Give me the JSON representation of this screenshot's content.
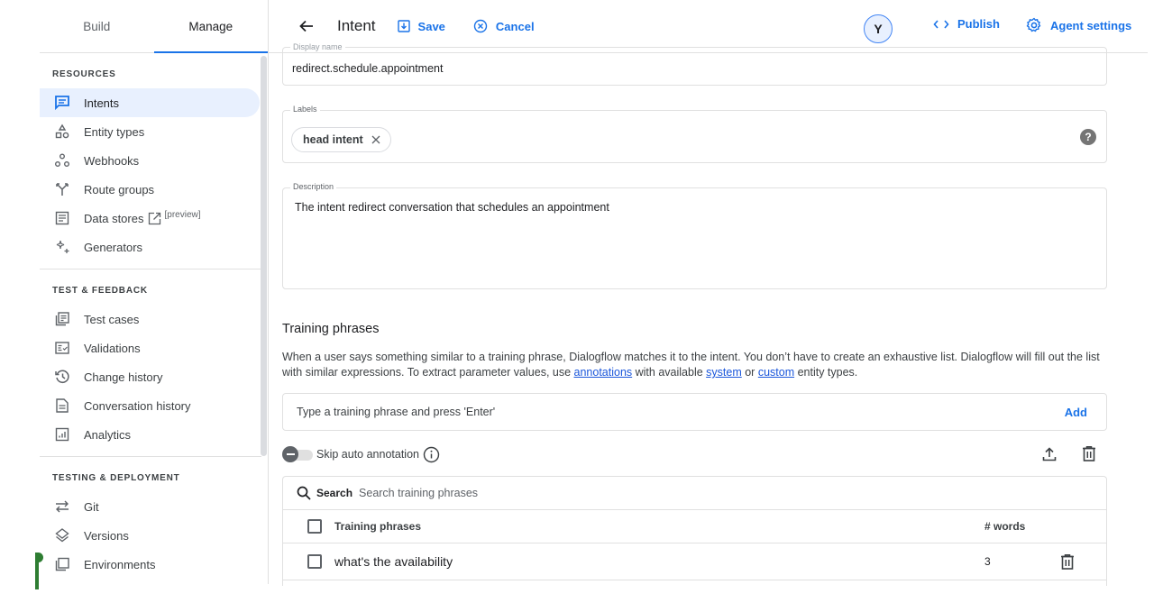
{
  "sidebar": {
    "tabs": [
      {
        "label": "Build",
        "active": false
      },
      {
        "label": "Manage",
        "active": true
      }
    ],
    "sections": {
      "resources": {
        "title": "RESOURCES",
        "items": [
          {
            "label": "Intents",
            "icon": "intents-icon",
            "active": true
          },
          {
            "label": "Entity types",
            "icon": "entity-types-icon"
          },
          {
            "label": "Webhooks",
            "icon": "webhooks-icon"
          },
          {
            "label": "Route groups",
            "icon": "route-groups-icon"
          },
          {
            "label": "Data stores",
            "icon": "data-stores-icon",
            "tag": "[preview]"
          },
          {
            "label": "Generators",
            "icon": "generators-icon"
          }
        ]
      },
      "test_feedback": {
        "title": "TEST & FEEDBACK",
        "items": [
          {
            "label": "Test cases",
            "icon": "test-cases-icon"
          },
          {
            "label": "Validations",
            "icon": "validations-icon"
          },
          {
            "label": "Change history",
            "icon": "change-history-icon"
          },
          {
            "label": "Conversation history",
            "icon": "conversation-history-icon"
          },
          {
            "label": "Analytics",
            "icon": "analytics-icon"
          }
        ]
      },
      "testing_deployment": {
        "title": "TESTING & DEPLOYMENT",
        "items": [
          {
            "label": "Git",
            "icon": "git-icon"
          },
          {
            "label": "Versions",
            "icon": "versions-icon"
          },
          {
            "label": "Environments",
            "icon": "environments-icon"
          }
        ]
      }
    }
  },
  "header": {
    "title": "Intent",
    "save_label": "Save",
    "cancel_label": "Cancel",
    "avatar_initial": "Y",
    "publish_label": "Publish",
    "agent_settings_label": "Agent settings"
  },
  "form": {
    "display_name": {
      "label": "Display name",
      "value": "redirect.schedule.appointment"
    },
    "labels": {
      "label": "Labels",
      "chips": [
        "head intent"
      ]
    },
    "description": {
      "label": "Description",
      "value": "The intent redirect conversation that schedules an appointment"
    }
  },
  "training": {
    "title": "Training phrases",
    "desc_part1": "When a user says something similar to a training phrase, Dialogflow matches it to the intent. You don’t have to create an exhaustive list. Dialogflow will fill out the list with similar expressions. To extract parameter values, use ",
    "link_annotations": "annotations",
    "desc_part2": " with available ",
    "link_system": "system",
    "desc_part3": " or ",
    "link_custom": "custom",
    "desc_part4": " entity types.",
    "input_placeholder": "Type a training phrase and press 'Enter'",
    "add_label": "Add",
    "skip_auto_annotation_label": "Skip auto annotation",
    "search_label": "Search",
    "search_placeholder": "Search training phrases",
    "columns": {
      "phrase": "Training phrases",
      "words": "# words"
    },
    "rows": [
      {
        "phrase": "what's the availability",
        "words": "3"
      }
    ]
  },
  "colors": {
    "accent": "#1a73e8",
    "active_nav_bg": "#e8f0fe",
    "flag_green": "#2e7d32"
  }
}
